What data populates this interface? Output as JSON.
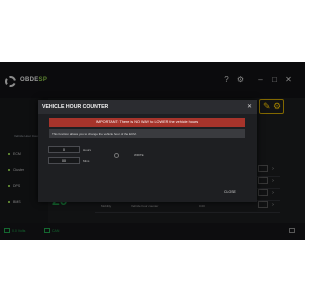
{
  "app": {
    "logo_prefix": "OBDE",
    "logo_accent": "SP",
    "sidebar_info": "Vehicle Hour Counter",
    "sidebar_items": [
      {
        "label": "ECM"
      },
      {
        "label": "Cluster"
      },
      {
        "label": "DPS"
      },
      {
        "label": "BMS"
      }
    ],
    "big_value": "20",
    "status_items": [
      {
        "label": "0.0 Volts"
      },
      {
        "label": "CAN"
      }
    ],
    "table_row": {
      "col1": "Mobility",
      "col2": "Vehicle hour counter",
      "col3": "0.00"
    },
    "colors": {
      "accent_green": "#1f9e4a",
      "tool_yellow": "#f5c400",
      "warning_red": "#a7342b"
    }
  },
  "modal": {
    "title": "VEHICLE HOUR COUNTER",
    "warning": "IMPORTANT: There is NO WAY to LOWER the vehicle hours",
    "info": "This function allows you to change the vehicle hour of the ECM.",
    "hours_value": "0",
    "hours_unit": "Hours",
    "mins_value": "00",
    "mins_unit": "Mins",
    "radio_label": "WRITE",
    "close_label": "CLOSE"
  }
}
